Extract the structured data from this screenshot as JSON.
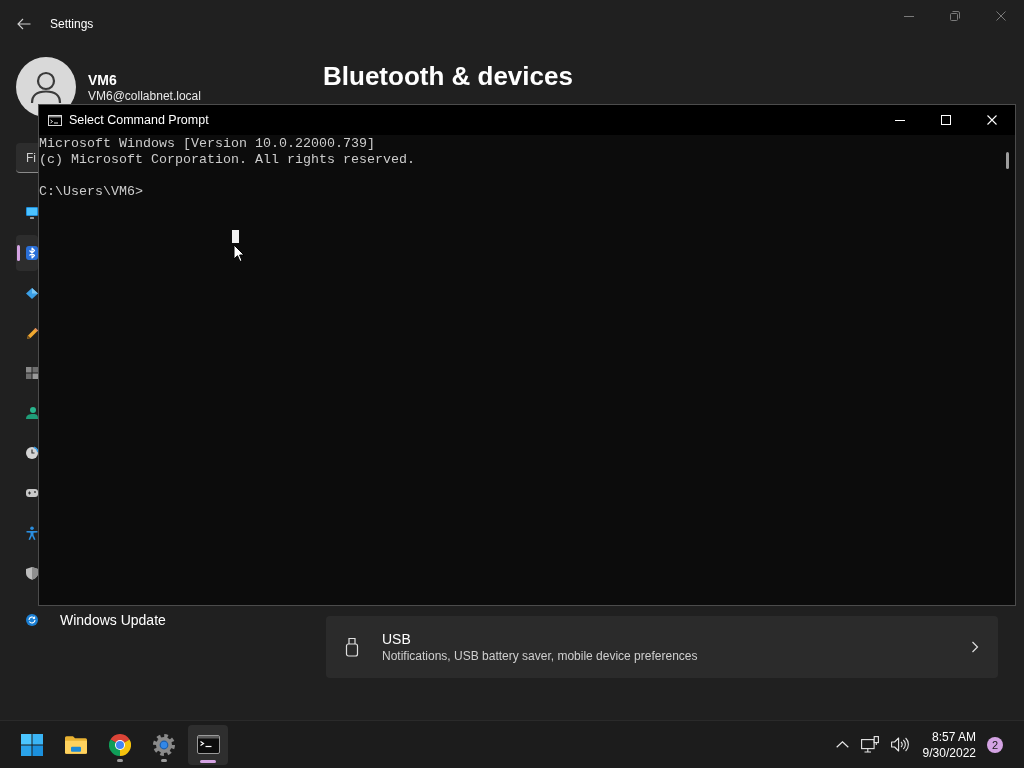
{
  "settings_window": {
    "title": "Settings",
    "user": {
      "name": "VM6",
      "email": "VM6@collabnet.local"
    },
    "search": {
      "placeholder": "Fi"
    },
    "sidebar": {
      "items": [
        {
          "selected": false
        },
        {
          "selected": true
        },
        {
          "selected": false
        },
        {
          "selected": false
        },
        {
          "selected": false
        },
        {
          "selected": false
        },
        {
          "selected": false
        },
        {
          "selected": false
        },
        {
          "selected": false
        },
        {
          "selected": false
        },
        {
          "label": "Windows Update",
          "selected": false
        }
      ]
    },
    "page_title": "Bluetooth & devices",
    "cards": [
      {
        "title": "USB",
        "description": "Notifications, USB battery saver, mobile device preferences"
      }
    ]
  },
  "console_window": {
    "title": "Select Command Prompt",
    "output": [
      "Microsoft Windows [Version 10.0.22000.739]",
      "(c) Microsoft Corporation. All rights reserved."
    ],
    "prompt": "C:\\Users\\VM6>"
  },
  "taskbar": {
    "apps": [
      {
        "running": false,
        "selected": false
      },
      {
        "running": false,
        "selected": false
      },
      {
        "running": true,
        "selected": false
      },
      {
        "running": true,
        "selected": false
      },
      {
        "running": true,
        "selected": true
      }
    ],
    "clock": {
      "time": "8:57 AM",
      "date": "9/30/2022"
    },
    "notification_badge": "2"
  }
}
